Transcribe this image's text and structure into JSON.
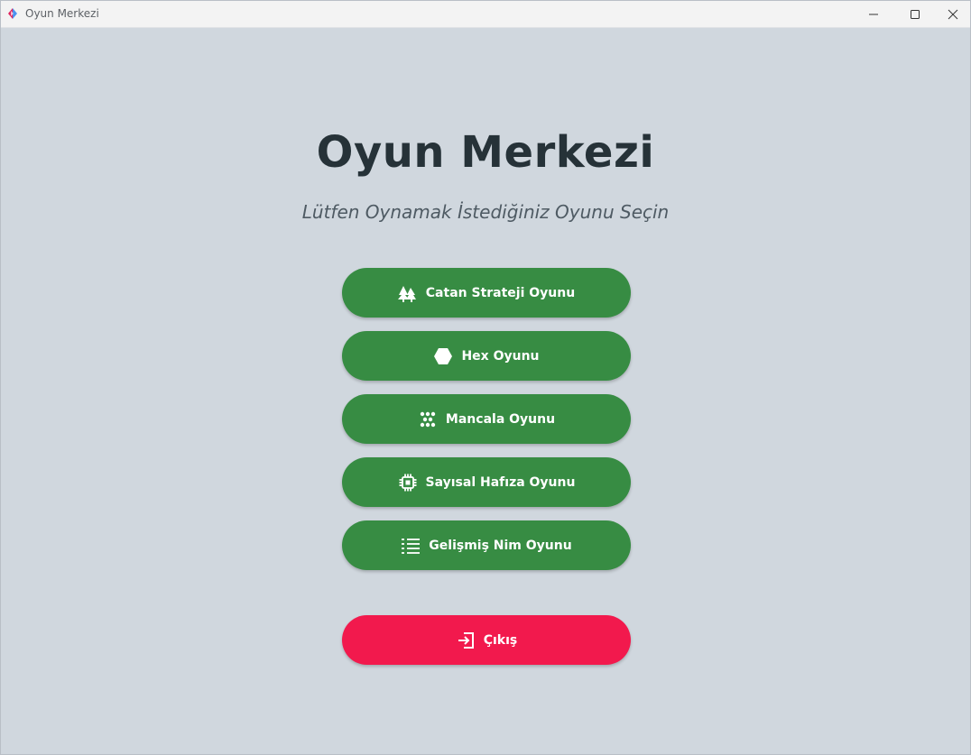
{
  "window": {
    "title": "Oyun Merkezi"
  },
  "header": {
    "title": "Oyun Merkezi",
    "subtitle": "Lütfen Oynamak İstediğiniz Oyunu Seçin"
  },
  "games": [
    {
      "label": "Catan Strateji Oyunu",
      "icon": "trees-icon"
    },
    {
      "label": "Hex Oyunu",
      "icon": "hexagon-icon"
    },
    {
      "label": "Mancala Oyunu",
      "icon": "dots-icon"
    },
    {
      "label": "Sayısal Hafıza Oyunu",
      "icon": "chip-icon"
    },
    {
      "label": "Gelişmiş Nim Oyunu",
      "icon": "list-icon"
    }
  ],
  "exit": {
    "label": "Çıkış",
    "icon": "exit-icon"
  },
  "colors": {
    "background": "#d0d7de",
    "game_button": "#378c43",
    "exit_button": "#f2194d",
    "title_text": "#263238"
  }
}
